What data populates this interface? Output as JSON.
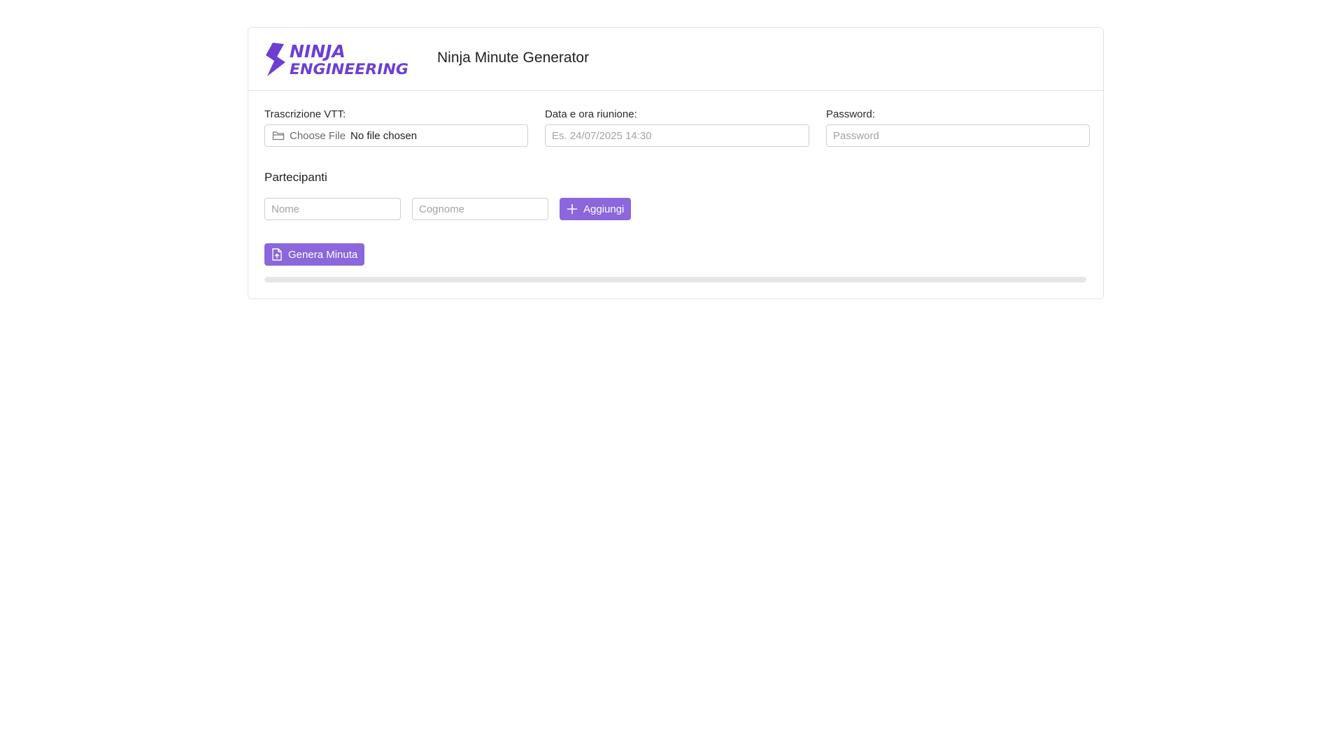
{
  "header": {
    "logo_line1": "NINJA",
    "logo_line2": "ENGINEERING",
    "title": "Ninja Minute Generator"
  },
  "form": {
    "vtt": {
      "label": "Trascrizione VTT:",
      "button_label": "Choose File",
      "status": "No file chosen"
    },
    "datetime": {
      "label": "Data e ora riunione:",
      "value": "",
      "placeholder": "Es. 24/07/2025 14:30"
    },
    "password": {
      "label": "Password:",
      "value": "",
      "placeholder": "Password"
    }
  },
  "participants": {
    "title": "Partecipanti",
    "first_name_placeholder": "Nome",
    "last_name_placeholder": "Cognome",
    "add_label": "Aggiungi"
  },
  "actions": {
    "generate_label": "Genera Minuta"
  },
  "progress": {
    "percent": 0
  },
  "icons": {
    "logo": "ninja-logo-icon",
    "file": "folder-icon",
    "add": "plus-icon",
    "generate": "file-upload-icon"
  },
  "colors": {
    "accent": "#8b66dc",
    "logo": "#6d3fd1",
    "border": "#e2e2e2",
    "progress_track": "#e6e6e6"
  }
}
